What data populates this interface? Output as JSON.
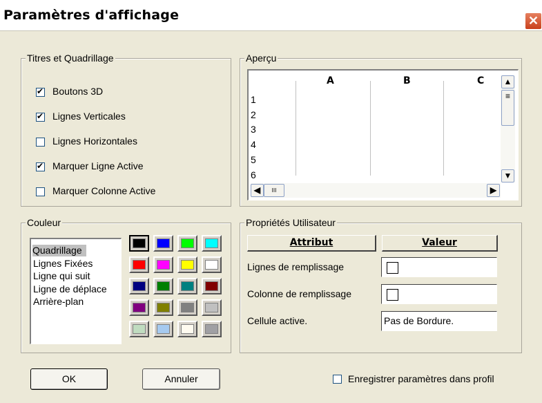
{
  "window": {
    "title": "Paramètres d'affichage",
    "close_glyph": "✕"
  },
  "titres": {
    "legend": "Titres et Quadrillage",
    "items": [
      {
        "label": "Boutons 3D",
        "checked": true
      },
      {
        "label": "Lignes Verticales",
        "checked": true
      },
      {
        "label": "Lignes Horizontales",
        "checked": false
      },
      {
        "label": "Marquer Ligne Active",
        "checked": true
      },
      {
        "label": "Marquer Colonne Active",
        "checked": false
      }
    ]
  },
  "apercu": {
    "legend": "Aperçu",
    "columns": [
      "A",
      "B",
      "C"
    ],
    "rows": [
      "1",
      "2",
      "3",
      "4",
      "5",
      "6"
    ],
    "scroll_up": "▲",
    "scroll_down": "▼",
    "scroll_left": "◀",
    "scroll_right": "▶",
    "hscroll_grip": "III"
  },
  "couleur": {
    "legend": "Couleur",
    "items": [
      "Quadrillage",
      "Lignes Fixées",
      "Ligne qui suit",
      "Ligne de déplace",
      "Arrière-plan"
    ],
    "selected": "Quadrillage",
    "palette": [
      [
        "#000000",
        "#0000ff",
        "#00ff00",
        "#00ffff"
      ],
      [
        "#ff0000",
        "#ff00ff",
        "#ffff00",
        "#ffffff"
      ],
      [
        "#000080",
        "#008000",
        "#008080",
        "#800000"
      ],
      [
        "#800080",
        "#808000",
        "#808080",
        "#c0c0c0"
      ],
      [
        "#c0dcc0",
        "#a6caf0",
        "#fffbf0",
        "#a0a0a4"
      ]
    ]
  },
  "proprietes": {
    "legend": "Propriétés Utilisateur",
    "col_attribut": "Attribut",
    "col_valeur": "Valeur",
    "rows": [
      {
        "label": "Lignes de remplissage",
        "value": ""
      },
      {
        "label": "Colonne de remplissage",
        "value": ""
      },
      {
        "label": "Cellule active.",
        "value": "Pas de Bordure."
      }
    ]
  },
  "footer": {
    "ok_label": "OK",
    "cancel_label": "Annuler",
    "save_label": "Enregistrer paramètres dans profil",
    "save_checked": false
  }
}
